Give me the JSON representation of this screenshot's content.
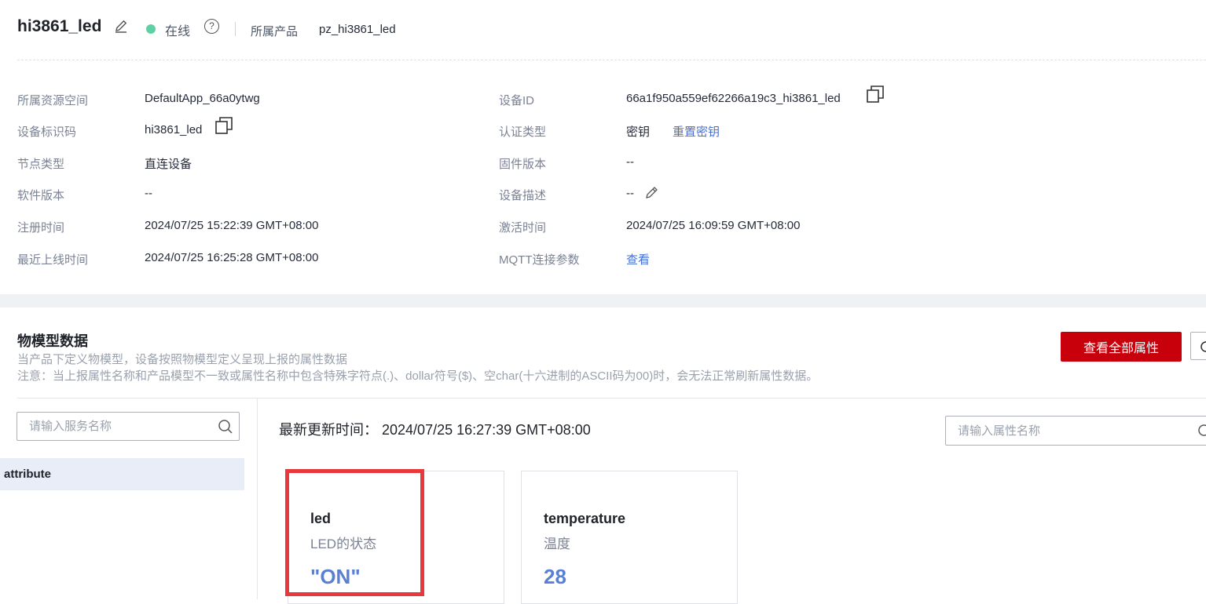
{
  "header": {
    "device_name": "hi3861_led",
    "status": "在线",
    "status_color": "#5fd0a5",
    "product_label": "所属产品",
    "product_value": "pz_hi3861_led"
  },
  "info": {
    "left": [
      {
        "label": "所属资源空间",
        "value": "DefaultApp_66a0ytwg"
      },
      {
        "label": "设备标识码",
        "value": "hi3861_led"
      },
      {
        "label": "节点类型",
        "value": "直连设备"
      },
      {
        "label": "软件版本",
        "value": "--"
      },
      {
        "label": "注册时间",
        "value": "2024/07/25 15:22:39 GMT+08:00"
      },
      {
        "label": "最近上线时间",
        "value": "2024/07/25 16:25:28 GMT+08:00"
      }
    ],
    "right": [
      {
        "label": "设备ID",
        "value": "66a1f950a559ef62266a19c3_hi3861_led"
      },
      {
        "label": "认证类型",
        "value": "密钥",
        "link": "重置密钥"
      },
      {
        "label": "固件版本",
        "value": "--"
      },
      {
        "label": "设备描述",
        "value": "--"
      },
      {
        "label": "激活时间",
        "value": "2024/07/25 16:09:59 GMT+08:00"
      },
      {
        "label": "MQTT连接参数",
        "link": "查看"
      }
    ]
  },
  "model": {
    "title": "物模型数据",
    "desc": "当产品下定义物模型，设备按照物模型定义呈现上报的属性数据",
    "note": "注意：当上报属性名称和产品模型不一致或属性名称中包含特殊字符点(.)、dollar符号($)、空char(十六进制的ASCII码为00)时，会无法正常刷新属性数据。",
    "view_all_button": "查看全部属性",
    "brand_color": "#c7000b"
  },
  "services": {
    "search_placeholder": "请输入服务名称",
    "items": [
      "attribute"
    ]
  },
  "properties": {
    "update_label": "最新更新时间：",
    "update_time": "2024/07/25 16:27:39 GMT+08:00",
    "search_placeholder": "请输入属性名称",
    "cards": [
      {
        "name": "led",
        "desc": "LED的状态",
        "value": "\"ON\""
      },
      {
        "name": "temperature",
        "desc": "温度",
        "value": "28"
      }
    ]
  }
}
